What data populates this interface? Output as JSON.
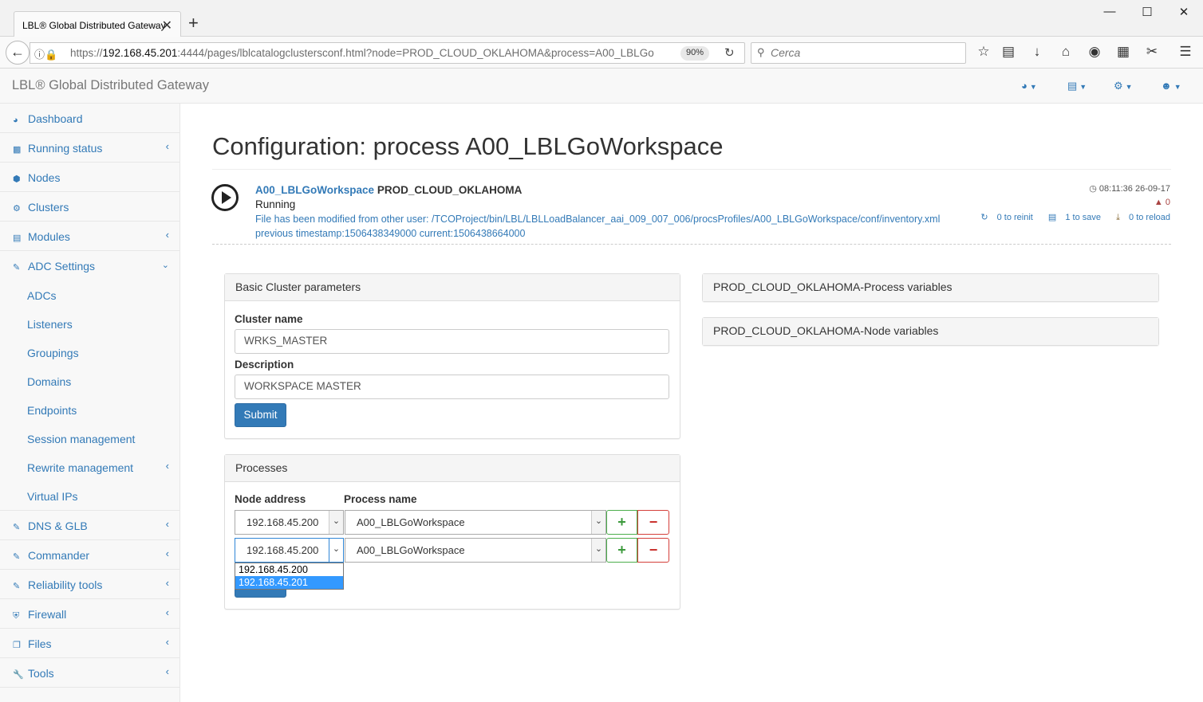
{
  "browser": {
    "tab_title": "LBL® Global Distributed Gateway",
    "close_tab": "✕",
    "new_tab": "+",
    "url_host_prefix": "https://",
    "url_host": "192.168.45.201",
    "url_rest": ":4444/pages/lblcatalogclustersconf.html?node=PROD_CLOUD_OKLAHOMA&process=A00_LBLGo",
    "zoom": "90%",
    "search_placeholder": "Cerca",
    "window_controls": {
      "minimize": "—",
      "maximize": "☐",
      "close": "✕"
    }
  },
  "app": {
    "brand": "LBL® Global Distributed Gateway"
  },
  "sidebar": {
    "items": [
      {
        "label": "Dashboard",
        "icon": "dashboard-icon"
      },
      {
        "label": "Running status",
        "icon": "bar-chart-icon",
        "expandable": true
      },
      {
        "label": "Nodes",
        "icon": "cube-icon"
      },
      {
        "label": "Clusters",
        "icon": "cogs-icon"
      },
      {
        "label": "Modules",
        "icon": "list-icon",
        "expandable": true
      },
      {
        "label": "ADC Settings",
        "icon": "edit-icon",
        "expanded": true
      },
      {
        "label": "ADCs"
      },
      {
        "label": "Listeners"
      },
      {
        "label": "Groupings"
      },
      {
        "label": "Domains"
      },
      {
        "label": "Endpoints"
      },
      {
        "label": "Session management"
      },
      {
        "label": "Rewrite management",
        "expandable": true
      },
      {
        "label": "Virtual IPs"
      },
      {
        "label": "DNS & GLB",
        "icon": "edit-icon",
        "expandable": true
      },
      {
        "label": "Commander",
        "icon": "edit-icon",
        "expandable": true
      },
      {
        "label": "Reliability tools",
        "icon": "edit-icon",
        "expandable": true
      },
      {
        "label": "Firewall",
        "icon": "shield-icon",
        "expandable": true
      },
      {
        "label": "Files",
        "icon": "files-icon",
        "expandable": true
      },
      {
        "label": "Tools",
        "icon": "wrench-icon",
        "expandable": true
      }
    ]
  },
  "page": {
    "title": "Configuration: process A00_LBLGoWorkspace"
  },
  "status": {
    "process": "A00_LBLGoWorkspace",
    "node": "PROD_CLOUD_OKLAHOMA",
    "state": "Running",
    "message_line1": "File has been modified from other user: /TCOProject/bin/LBL/LBLLoadBalancer_aai_009_007_006/procsProfiles/A00_LBLGoWorkspace/conf/inventory.xml",
    "message_line2": "previous timestamp:1506438349000 current:1506438664000",
    "timestamp": "08:11:36 26-09-17",
    "warnings": "0",
    "to_reinit": "0 to reinit",
    "to_save": "1 to save",
    "to_reload": "0 to reload"
  },
  "basic": {
    "heading": "Basic Cluster parameters",
    "cluster_name_label": "Cluster name",
    "cluster_name_value": "WRKS_MASTER",
    "description_label": "Description",
    "description_value": "WORKSPACE MASTER",
    "submit": "Submit"
  },
  "processes": {
    "heading": "Processes",
    "node_col": "Node address",
    "process_col": "Process name",
    "rows": [
      {
        "node": "192.168.45.200",
        "process": "A00_LBLGoWorkspace"
      },
      {
        "node": "192.168.45.200",
        "process": "A00_LBLGoWorkspace"
      }
    ],
    "plus": "+",
    "minus": "−",
    "dropdown_options": [
      "192.168.45.200",
      "192.168.45.201"
    ]
  },
  "right_panels": {
    "process_vars": "PROD_CLOUD_OKLAHOMA-Process variables",
    "node_vars": "PROD_CLOUD_OKLAHOMA-Node variables"
  },
  "colors": {
    "link": "#337ab7",
    "primary": "#337ab7",
    "success": "#4cae4c",
    "danger": "#d43f3a",
    "selection": "#3399ff"
  }
}
